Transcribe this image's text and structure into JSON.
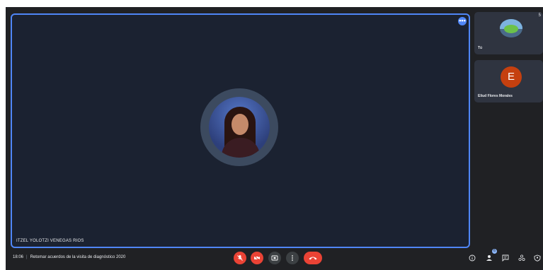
{
  "stage": {
    "participant_name": "ITZEL YOLOTZI VENEGAS RIOS",
    "badge": "•••"
  },
  "tiles": [
    {
      "label": "Tú",
      "corner": "5",
      "avatar": "logo"
    },
    {
      "label": "Eliud Flores Morales",
      "avatar_letter": "E"
    }
  ],
  "meeting": {
    "time": "18:06",
    "separator": "|",
    "title": "Retomar acuerdos de la visita de diagnóstico 2020"
  },
  "controls": [
    {
      "name": "mic-off",
      "icon": "mic-off-icon"
    },
    {
      "name": "camera-off",
      "icon": "camera-off-icon"
    },
    {
      "name": "present",
      "icon": "present-screen-icon"
    },
    {
      "name": "more-options",
      "icon": "more-vert-icon"
    },
    {
      "name": "leave-call",
      "icon": "call-end-icon"
    }
  ],
  "side_panel": {
    "people_count": "6",
    "icons": [
      "info-icon",
      "people-icon",
      "chat-icon",
      "activities-icon",
      "host-controls-icon"
    ]
  },
  "colors": {
    "accent": "#4f86f7",
    "danger": "#ea4335",
    "background": "#202124",
    "stage": "#1b2231"
  }
}
